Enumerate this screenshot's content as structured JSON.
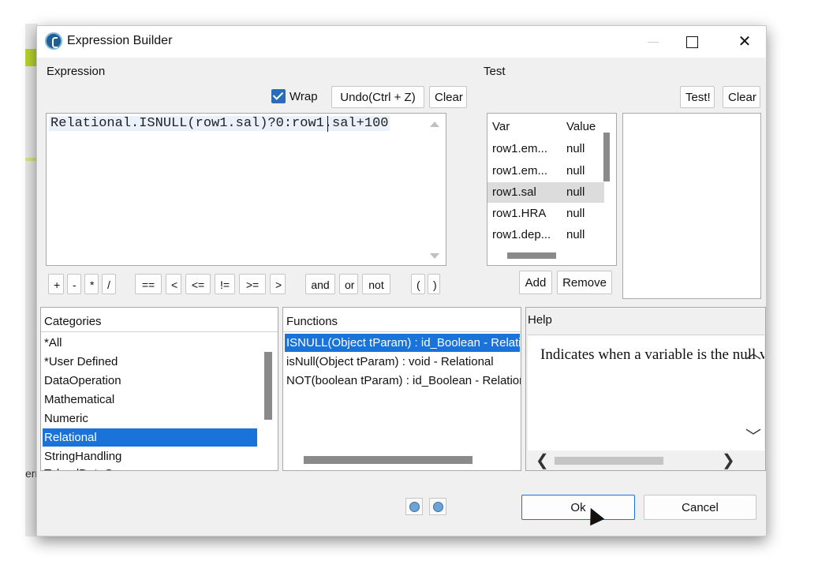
{
  "window": {
    "title": "Expression Builder"
  },
  "expression": {
    "section_label": "Expression",
    "wrap_label": "Wrap",
    "wrap_checked": true,
    "undo_label": "Undo(Ctrl + Z)",
    "clear_label": "Clear",
    "text": "Relational.ISNULL(row1.sal)?0:row1.sal+100"
  },
  "operators": [
    "+",
    "-",
    "*",
    "/",
    "==",
    "<",
    "<=",
    "!=",
    ">=",
    ">",
    "and",
    "or",
    "not",
    "(",
    ")"
  ],
  "test": {
    "section_label": "Test",
    "test_button": "Test!",
    "clear_button": "Clear",
    "columns": [
      "Var",
      "Value"
    ],
    "rows": [
      {
        "var": "row1.em...",
        "value": "null"
      },
      {
        "var": "row1.em...",
        "value": "null"
      },
      {
        "var": "row1.sal",
        "value": "null",
        "selected": true
      },
      {
        "var": "row1.HRA",
        "value": "null"
      },
      {
        "var": "row1.dep...",
        "value": "null"
      }
    ],
    "add_label": "Add",
    "remove_label": "Remove"
  },
  "categories": {
    "header": "Categories",
    "items": [
      "*All",
      "*User Defined",
      "DataOperation",
      "Mathematical",
      "Numeric",
      "Relational",
      "StringHandling",
      "TalendDataGe..."
    ],
    "selected": "Relational"
  },
  "functions": {
    "header": "Functions",
    "items": [
      "ISNULL(Object tParam) : id_Boolean - Relational",
      "isNull(Object tParam) : void - Relational",
      "NOT(boolean tParam) : id_Boolean - Relational"
    ],
    "selected_index": 0
  },
  "help": {
    "header": "Help",
    "text": "Indicates when a variable is the null value"
  },
  "footer": {
    "ok_label": "Ok",
    "cancel_label": "Cancel"
  },
  "colors": {
    "selection": "#1a73d9",
    "checkbox": "#2b6cb8"
  },
  "background": {
    "partial_text": "err"
  }
}
